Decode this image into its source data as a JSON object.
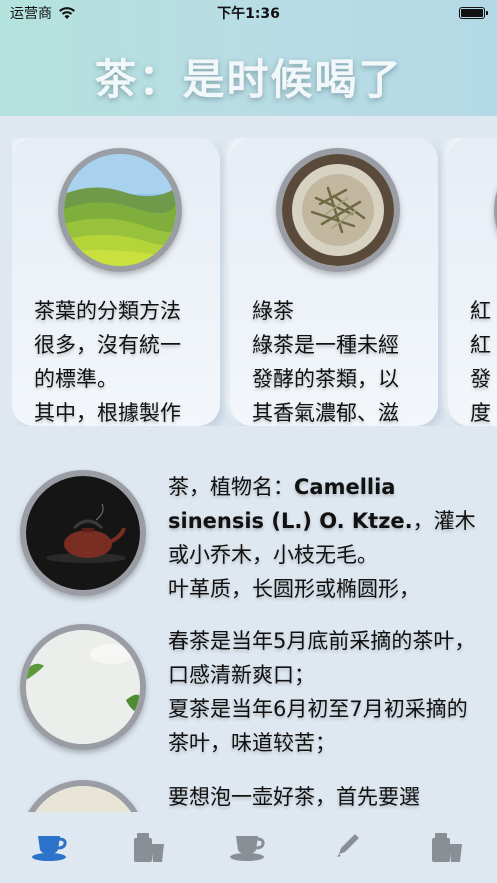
{
  "status": {
    "carrier": "运营商",
    "time": "下午1:36"
  },
  "header": {
    "title": "茶：是时候喝了"
  },
  "cards": [
    {
      "text": "茶葉的分類方法\n很多，沒有統一\n的標準。\n其中，根據製作",
      "image": "tea-plantation"
    },
    {
      "text": "綠茶\n綠茶是一種未經\n發酵的茶類，以\n其香氣濃郁、滋",
      "image": "green-tea-bowl"
    },
    {
      "text": "紅\n紅\n發\n度",
      "image": "black-tea"
    }
  ],
  "list": [
    {
      "text_a": "茶，植物名：",
      "text_b": "Camellia sinensis (L.) O. Ktze.",
      "text_c": "，灌木或小乔木，小枝无毛。\n叶革质，长圆形或椭圆形，",
      "image": "teapot"
    },
    {
      "text": "春茶是当年5月底前采摘的茶叶，口感清新爽口；\n夏茶是当年6月初至7月初采摘的茶叶，味道较苦；",
      "image": "tea-table"
    },
    {
      "text": "要想泡一壶好茶，首先要選",
      "image": "tea-cup"
    }
  ],
  "tabs": [
    {
      "icon": "teacup-icon",
      "active": true
    },
    {
      "icon": "tea-box-icon",
      "active": false
    },
    {
      "icon": "teacup-icon",
      "active": false
    },
    {
      "icon": "pencil-icon",
      "active": false
    },
    {
      "icon": "tea-box-icon",
      "active": false
    }
  ],
  "colors": {
    "active_tab": "#2b73c8",
    "inactive_tab": "#8a8f96",
    "background": "#dfe8f1",
    "header_start": "#b4e2dc"
  }
}
